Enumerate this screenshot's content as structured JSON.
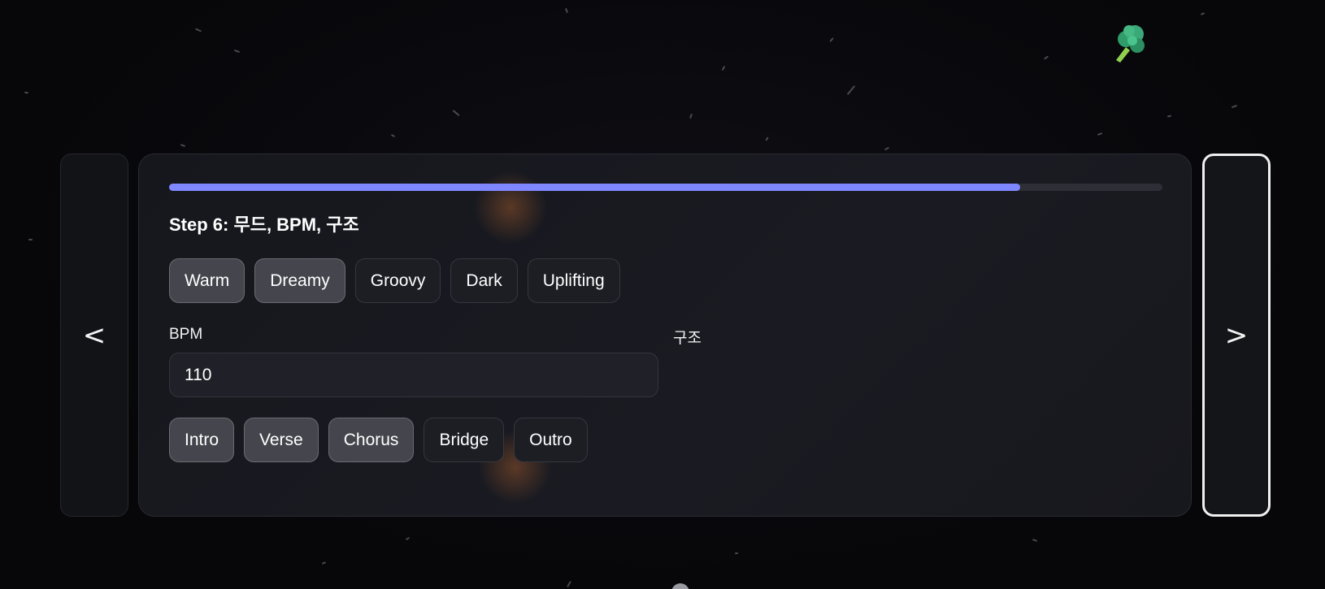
{
  "wizard": {
    "step_title": "Step 6: 무드, BPM, 구조",
    "progress": 0.857
  },
  "navigation": {
    "prev_label": "<",
    "next_label": ">"
  },
  "mood": {
    "chips": [
      {
        "label": "Warm",
        "selected": true
      },
      {
        "label": "Dreamy",
        "selected": true
      },
      {
        "label": "Groovy",
        "selected": false
      },
      {
        "label": "Dark",
        "selected": false
      },
      {
        "label": "Uplifting",
        "selected": false
      }
    ]
  },
  "bpm": {
    "label": "BPM",
    "value": "110"
  },
  "structure": {
    "label": "구조",
    "chips": [
      {
        "label": "Intro",
        "selected": true
      },
      {
        "label": "Verse",
        "selected": true
      },
      {
        "label": "Chorus",
        "selected": true
      },
      {
        "label": "Bridge",
        "selected": false
      },
      {
        "label": "Outro",
        "selected": false
      }
    ]
  },
  "decor": {
    "mascot_icon": "broccoli-icon",
    "accent_color": "#7e87ff"
  }
}
